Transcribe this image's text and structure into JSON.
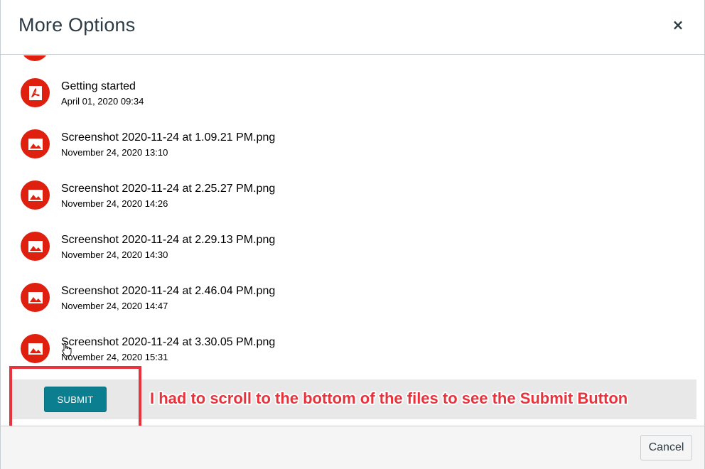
{
  "dialog": {
    "title": "More Options",
    "close_label": "×"
  },
  "files": [
    {
      "name": "Getting started",
      "date": "April 01, 2020 09:34",
      "type": "pdf",
      "icon": "pdf-file-icon"
    },
    {
      "name": "Screenshot 2020-11-24 at 1.09.21 PM.png",
      "date": "November 24, 2020 13:10",
      "type": "image",
      "icon": "image-file-icon"
    },
    {
      "name": "Screenshot 2020-11-24 at 2.25.27 PM.png",
      "date": "November 24, 2020 14:26",
      "type": "image",
      "icon": "image-file-icon"
    },
    {
      "name": "Screenshot 2020-11-24 at 2.29.13 PM.png",
      "date": "November 24, 2020 14:30",
      "type": "image",
      "icon": "image-file-icon"
    },
    {
      "name": "Screenshot 2020-11-24 at 2.46.04 PM.png",
      "date": "November 24, 2020 14:47",
      "type": "image",
      "icon": "image-file-icon"
    },
    {
      "name": "Screenshot 2020-11-24 at 3.30.05 PM.png",
      "date": "November 24, 2020 15:31",
      "type": "image",
      "icon": "image-file-icon"
    }
  ],
  "submit": {
    "label": "SUBMIT"
  },
  "annotation": {
    "text": "I had to scroll to the bottom of the files to see the Submit Button"
  },
  "footer": {
    "cancel_label": "Cancel"
  },
  "colors": {
    "file_icon": "#e0200f",
    "submit_button": "#0b7f8f",
    "annotation": "#e8323c"
  }
}
